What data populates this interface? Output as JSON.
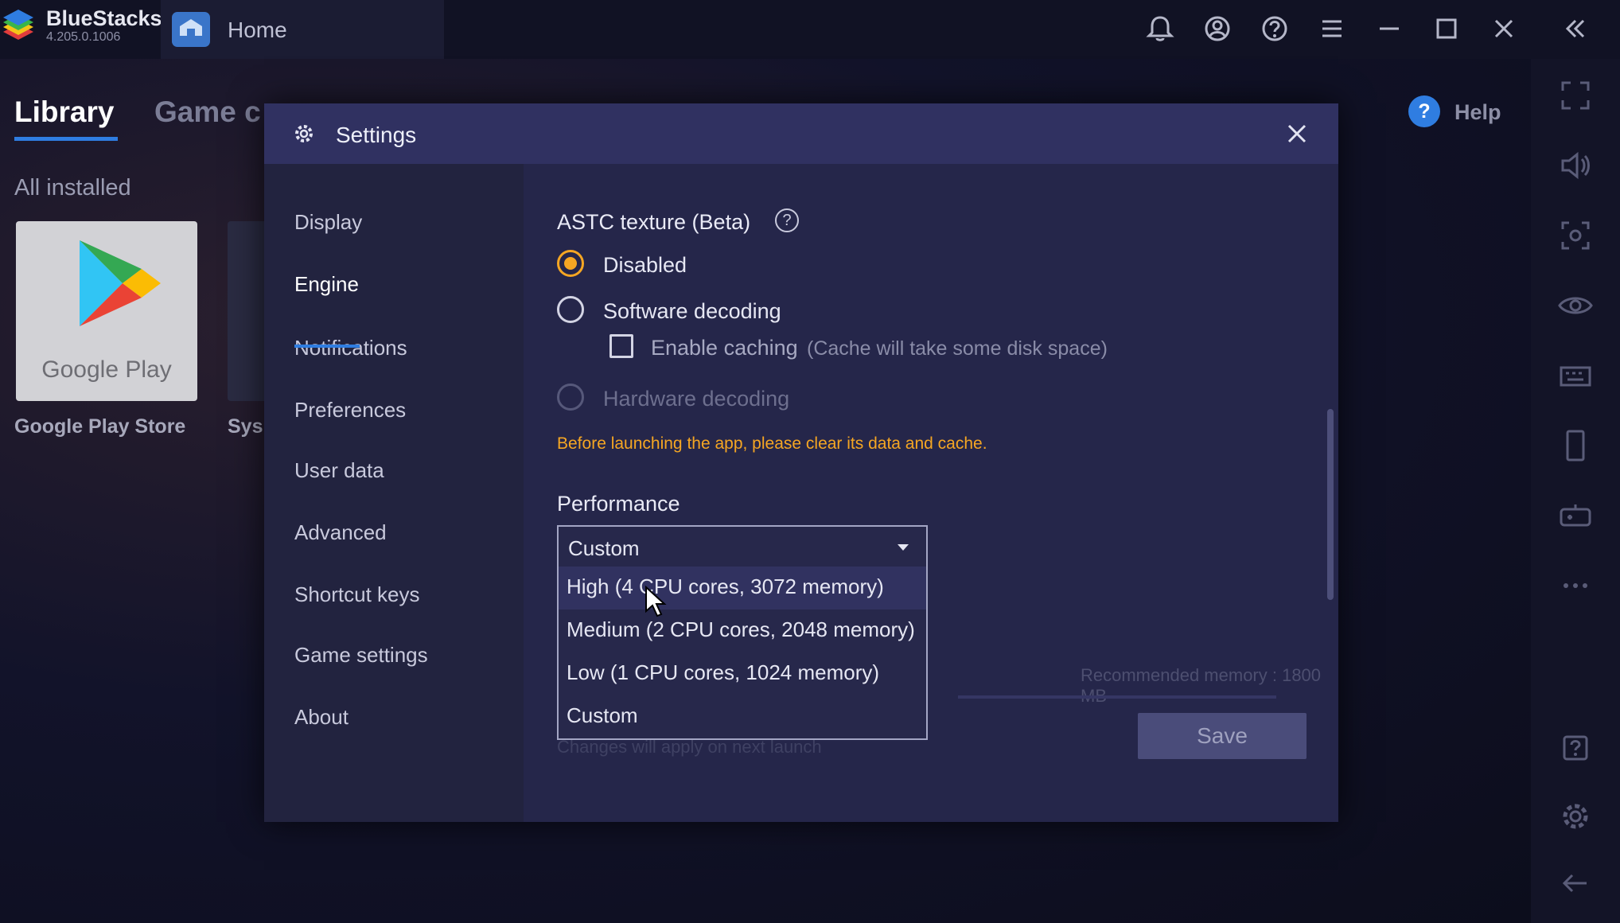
{
  "app": {
    "name": "BlueStacks",
    "version": "4.205.0.1006",
    "tab_label": "Home"
  },
  "library": {
    "tabs": [
      "Library",
      "Game c"
    ],
    "section": "All installed",
    "apps": [
      {
        "label": "Google Play Store",
        "tile_text": "Google Play"
      },
      {
        "label": "Sys"
      }
    ],
    "help_label": "Help"
  },
  "settings": {
    "title": "Settings",
    "nav": [
      "Display",
      "Engine",
      "Notifications",
      "Preferences",
      "User data",
      "Advanced",
      "Shortcut keys",
      "Game settings",
      "About"
    ],
    "active_nav": "Engine",
    "astc": {
      "label": "ASTC texture (Beta)",
      "options": [
        "Disabled",
        "Software decoding",
        "Hardware decoding"
      ],
      "selected": "Disabled",
      "caching_label": "Enable caching",
      "caching_hint": "(Cache will take some disk space)",
      "warning": "Before launching the app, please clear its data and cache."
    },
    "performance": {
      "label": "Performance",
      "selected": "Custom",
      "options": [
        "High (4 CPU cores, 3072 memory)",
        "Medium (2 CPU cores, 2048 memory)",
        "Low (1 CPU cores, 1024 memory)",
        "Custom"
      ],
      "recommended_memory": "Recommended memory : 1800 MB",
      "changes_note": "Changes will apply on next launch"
    },
    "save_label": "Save"
  },
  "colors": {
    "accent": "#2f7de1",
    "radio_selected": "#f5a623",
    "warning": "#f5a623",
    "modal_bg": "#25264a",
    "header_bg": "#303161"
  },
  "icons": {
    "titlebar": [
      "bell-icon",
      "account-icon",
      "help-icon",
      "menu-icon",
      "minimize-icon",
      "maximize-icon",
      "close-icon",
      "collapse-icon"
    ],
    "sidebar": [
      "fullscreen-icon",
      "volume-icon",
      "screenshot-icon",
      "eye-icon",
      "keyboard-icon",
      "phone-icon",
      "gamepad-icon",
      "more-icon",
      "help-icon",
      "settings-icon",
      "back-icon"
    ]
  }
}
